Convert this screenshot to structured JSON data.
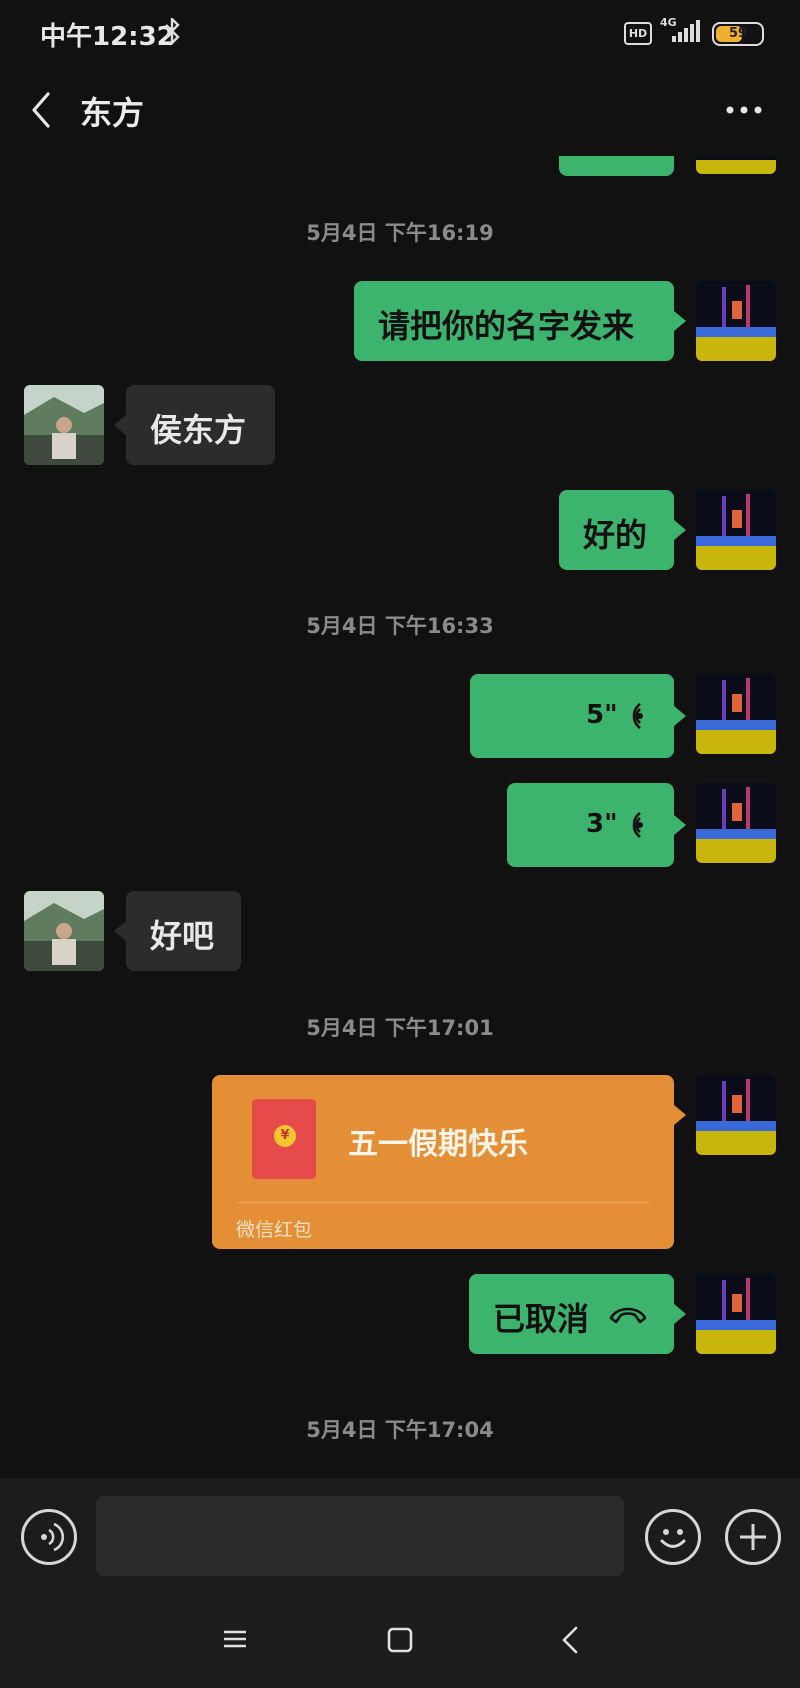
{
  "status_bar": {
    "time": "中午12:32",
    "hd_label": "HD",
    "network_label": "4G",
    "battery_level": "59",
    "battery_fraction": 0.59
  },
  "header": {
    "title": "东方",
    "back_icon": "chevron-left-icon",
    "more_icon": "more-dots-icon"
  },
  "messages": [
    {
      "type": "timestamp",
      "text": "5月4日 下午16:19"
    },
    {
      "type": "text",
      "side": "right",
      "text": "请把你的名字发来"
    },
    {
      "type": "text",
      "side": "left",
      "text": "侯东方"
    },
    {
      "type": "text",
      "side": "right",
      "text": "好的"
    },
    {
      "type": "timestamp",
      "text": "5月4日 下午16:33"
    },
    {
      "type": "voice",
      "side": "right",
      "duration": "5\""
    },
    {
      "type": "voice",
      "side": "right",
      "duration": "3\""
    },
    {
      "type": "text",
      "side": "left",
      "text": "好吧"
    },
    {
      "type": "timestamp",
      "text": "5月4日 下午17:01"
    },
    {
      "type": "red_packet",
      "side": "right",
      "title": "五一假期快乐",
      "label": "微信红包",
      "coin_symbol": "¥"
    },
    {
      "type": "call",
      "side": "right",
      "text": "已取消"
    },
    {
      "type": "timestamp",
      "text": "5月4日 下午17:04"
    }
  ],
  "input_bar": {
    "voice_icon": "voice-input-icon",
    "input_value": "",
    "emoji_icon": "emoji-icon",
    "plus_icon": "plus-icon"
  },
  "nav_bar": {
    "menu_icon": "menu-icon",
    "home_icon": "home-icon",
    "back_icon": "back-icon"
  },
  "colors": {
    "background": "#111111",
    "sent_bubble": "#3cb46e",
    "received_bubble": "#2c2c2c",
    "red_packet": "#e48f36"
  }
}
